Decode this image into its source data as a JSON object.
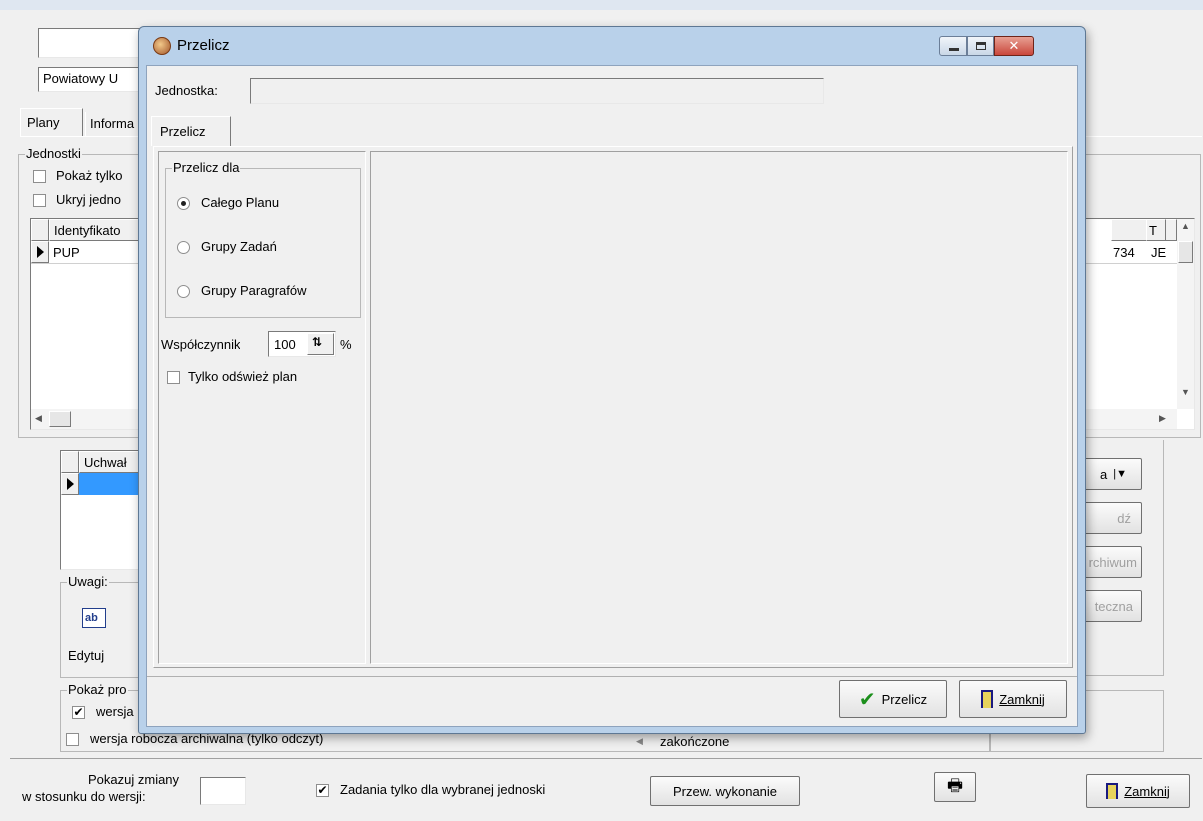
{
  "background": {
    "top_field_1": "",
    "top_field_2": "Powiatowy U",
    "tabs": [
      "Plany",
      "Informa"
    ],
    "units_group": {
      "title": "Jednostki",
      "show_only_label": "Pokaż tylko",
      "hide_units_label": "Ukryj jedno",
      "columns": [
        "Identyfikato",
        "T"
      ],
      "row": {
        "identifier": "PUP",
        "right_value": "734",
        "type_value": "JE"
      }
    },
    "resolutions": {
      "column": "Uchwał",
      "buttons": [
        "a",
        "dź",
        "rchiwum",
        "teczna"
      ]
    },
    "notes_group": {
      "title": "Uwagi:",
      "edit_label": "Edytuj",
      "icon_text": "ab"
    },
    "show_group": {
      "title": "Pokaż pro",
      "version_label": "wersja",
      "archived_label": "wersja robocza archiwalna (tylko odczyt)",
      "finished_label": "zakończone"
    },
    "bottom": {
      "show_changes_line1": "Pokazuj zmiany",
      "show_changes_line2": "w stosunku do wersji:",
      "version_value": "",
      "tasks_only_label": "Zadania tylko dla wybranej jednoski",
      "execution_button": "Przew. wykonanie",
      "close_button": "Zamknij"
    }
  },
  "dialog": {
    "title": "Przelicz",
    "unit_label": "Jednostka:",
    "unit_value": "",
    "tab": "Przelicz",
    "recalc_group": {
      "title": "Przelicz dla",
      "options": [
        "Całego Planu",
        "Grupy Zadań",
        "Grupy Paragrafów"
      ],
      "selected": 0
    },
    "factor_label": "Współczynnik",
    "factor_value": "100",
    "factor_unit": "%",
    "refresh_only_label": "Tylko odśwież plan",
    "recalc_button": "Przelicz",
    "close_button": "Zamknij"
  },
  "colors": {
    "dialog_frame": "#b9d1ea",
    "close_red": "#c9473c",
    "selection": "#3399ff"
  }
}
